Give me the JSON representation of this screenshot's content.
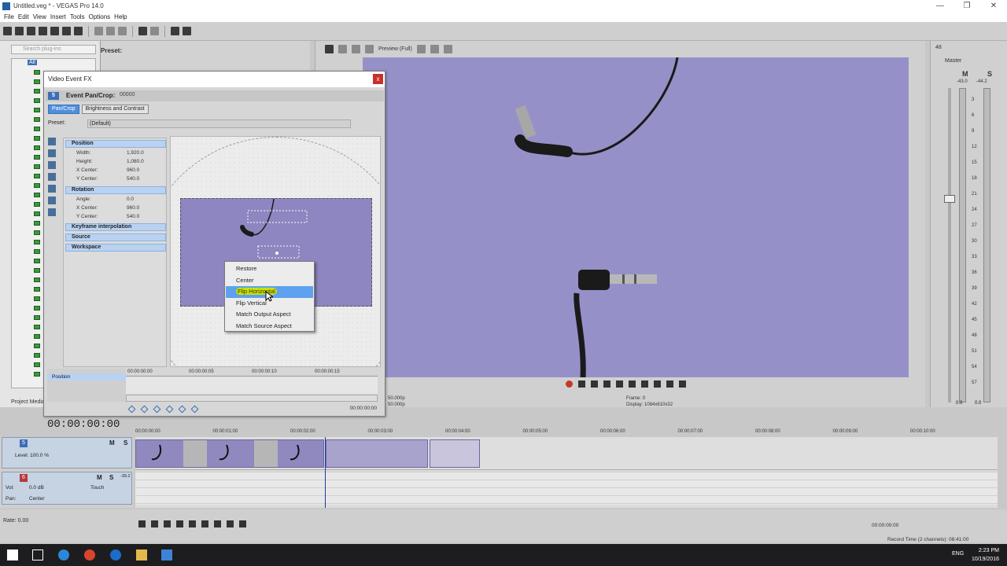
{
  "window": {
    "title": "Untitled.veg * - VEGAS Pro 14.0",
    "controls": [
      "—",
      "❐",
      "✕"
    ]
  },
  "menu": [
    "File",
    "Edit",
    "View",
    "Insert",
    "Tools",
    "Options",
    "Help"
  ],
  "explorer": {
    "search_placeholder": "Search plug-ins",
    "root_item": "All",
    "tab_label": "Project Media",
    "preset_label": "Preset:"
  },
  "preview": {
    "quality_label": "Preview (Full)",
    "project_line1": "50.000p",
    "project_line2": "50.000p",
    "frame_label": "Frame:",
    "frame_value": "0",
    "display_label": "Display:",
    "display_value": "1084x610x32"
  },
  "master": {
    "title": "Master",
    "level_top": "48",
    "left_peak": "-43.0",
    "right_peak": "-44.2",
    "m_label": "M",
    "s_label": "S",
    "scale": [
      "3",
      "6",
      "9",
      "12",
      "15",
      "18",
      "21",
      "24",
      "27",
      "30",
      "33",
      "36",
      "39",
      "42",
      "45",
      "48",
      "51",
      "54",
      "57"
    ],
    "bottom_left": "0.0",
    "bottom_right": "0.0"
  },
  "vfx": {
    "title": "Video Event FX",
    "close": "x",
    "event_number": "5",
    "header_label": "Event Pan/Crop:",
    "header_value": "00000",
    "chain": [
      "Pan/Crop",
      "Brightness and Contrast"
    ],
    "preset_label": "Preset:",
    "preset_value": "(Default)",
    "sections": {
      "position": "Position",
      "rotation": "Rotation",
      "keyframe": "Keyframe interpolation",
      "source": "Source",
      "workspace": "Workspace"
    },
    "position_rows": [
      {
        "label": "Width:",
        "value": "1,920.0"
      },
      {
        "label": "Height:",
        "value": "1,080.0"
      },
      {
        "label": "X Center:",
        "value": "960.0"
      },
      {
        "label": "Y Center:",
        "value": "540.0"
      }
    ],
    "rotation_rows": [
      {
        "label": "Angle:",
        "value": "0.0"
      },
      {
        "label": "X Center:",
        "value": "960.0"
      },
      {
        "label": "Y Center:",
        "value": "540.0"
      }
    ],
    "kf_track_label": "Position",
    "kf_ruler": [
      "00:00:00:00",
      "00:00:00:05",
      "00:00:00:10",
      "00:00:00:15"
    ],
    "kf_time": "00:00:00:00"
  },
  "context_menu": {
    "items": [
      "Restore",
      "Center",
      "Flip Horizontal",
      "Flip Vertical",
      "Match Output Aspect",
      "Match Source Aspect"
    ],
    "highlighted_index": 2
  },
  "timeline": {
    "timecode": "00:00:00:00",
    "ruler": [
      "00:00:00:00",
      "00:00:01:00",
      "00:00:02:00",
      "00:00:03:00",
      "00:00:04:00",
      "00:00:05:00",
      "00:00:06:00",
      "00:00:07:00",
      "00:00:08:00",
      "00:00:09:00",
      "00:00:10:00"
    ],
    "video_track": {
      "number": "5",
      "level_label": "Level: 100.0 %",
      "m": "M",
      "s": "S"
    },
    "audio_track": {
      "number": "6",
      "vol_label": "Vol:",
      "vol_value": "0.0 dB",
      "pan_label": "Pan:",
      "pan_value": "Center",
      "touch_label": "Touch",
      "meter_value": "-39.2",
      "m": "M",
      "s": "S"
    }
  },
  "transport": {
    "rate": "Rate: 0.00",
    "cursor_time": "00:00:00:00",
    "record_time": "Record Time (2 channels): 08:41:00"
  },
  "taskbar": {
    "time": "2:23 PM",
    "date": "10/19/2016",
    "lang": "ENG"
  },
  "colors": {
    "accent": "#4f8fdc",
    "video_bg": "#9690c8",
    "menu_highlight": "#5da1ef",
    "record": "#c0392b"
  }
}
